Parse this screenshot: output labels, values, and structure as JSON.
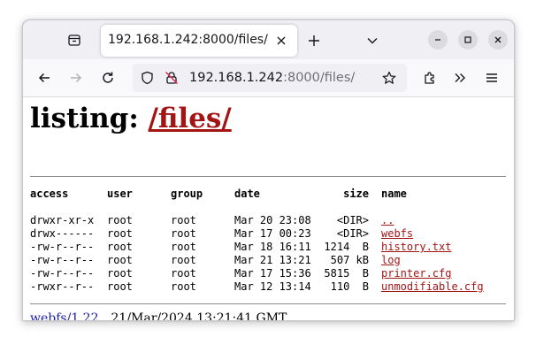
{
  "browser": {
    "tab_title": "192.168.1.242:8000/files/",
    "url_host": "192.168.1.242",
    "url_rest": ":8000/files/"
  },
  "page": {
    "heading_prefix": "listing: ",
    "heading_path": "/files/",
    "columns": {
      "access": "access",
      "user": "user",
      "group": "group",
      "date": "date",
      "size": "size",
      "name": "name"
    },
    "rows": [
      {
        "access": "drwxr-xr-x",
        "user": "root",
        "group": "root",
        "date": "Mar 20 23:08",
        "size": "<DIR>",
        "name": ".."
      },
      {
        "access": "drwx------",
        "user": "root",
        "group": "root",
        "date": "Mar 17 00:23",
        "size": "<DIR>",
        "name": "webfs"
      },
      {
        "access": "-rw-r--r--",
        "user": "root",
        "group": "root",
        "date": "Mar 18 16:11",
        "size": "1214  B",
        "name": "history.txt"
      },
      {
        "access": "-rw-r--r--",
        "user": "root",
        "group": "root",
        "date": "Mar 21 13:21",
        "size": "507 kB",
        "name": "log"
      },
      {
        "access": "-rw-r--r--",
        "user": "root",
        "group": "root",
        "date": "Mar 17 15:36",
        "size": "5815  B",
        "name": "printer.cfg"
      },
      {
        "access": "-rwxr--r--",
        "user": "root",
        "group": "root",
        "date": "Mar 12 13:14",
        "size": "110  B",
        "name": "unmodifiable.cfg"
      }
    ],
    "footer_link": "webfs/1.22",
    "footer_date": "21/Mar/2024 13:21:41 GMT"
  },
  "colors": {
    "link_visited": "#a31515",
    "link": "#1a1aa8",
    "tabbar_bg": "#f0f0f4",
    "navbar_bg": "#f9f9fb"
  },
  "icons": [
    "tab-list-icon",
    "close-icon",
    "plus-icon",
    "chevron-down-icon",
    "minimize-icon",
    "maximize-icon",
    "window-close-icon",
    "back-arrow-icon",
    "forward-arrow-icon",
    "reload-icon",
    "shield-icon",
    "insecure-lock-icon",
    "bookmark-star-icon",
    "extensions-icon",
    "overflow-chevrons-icon",
    "hamburger-menu-icon"
  ]
}
